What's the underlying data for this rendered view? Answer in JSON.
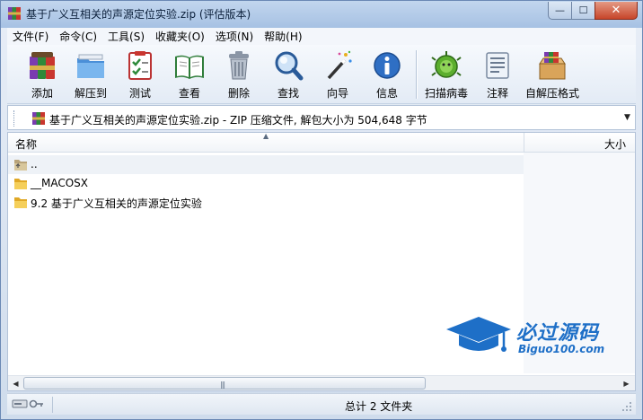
{
  "window": {
    "title": "基于广义互相关的声源定位实验.zip (评估版本)",
    "controls": {
      "minimize": "—",
      "maximize": "☐",
      "close": "✕"
    }
  },
  "menu": [
    "文件(F)",
    "命令(C)",
    "工具(S)",
    "收藏夹(O)",
    "选项(N)",
    "帮助(H)"
  ],
  "toolbar": {
    "items": [
      {
        "label": "添加",
        "icon": "add-archive-icon"
      },
      {
        "label": "解压到",
        "icon": "extract-folder-icon"
      },
      {
        "label": "测试",
        "icon": "test-checklist-icon"
      },
      {
        "label": "查看",
        "icon": "view-book-icon"
      },
      {
        "label": "删除",
        "icon": "trash-icon"
      },
      {
        "label": "查找",
        "icon": "find-magnifier-icon"
      },
      {
        "label": "向导",
        "icon": "wizard-wand-icon"
      },
      {
        "label": "信息",
        "icon": "info-icon"
      },
      {
        "label": "扫描病毒",
        "icon": "virus-scan-icon"
      },
      {
        "label": "注释",
        "icon": "comment-icon"
      },
      {
        "label": "自解压格式",
        "icon": "sfx-box-icon"
      }
    ]
  },
  "address": {
    "text": "基于广义互相关的声源定位实验.zip - ZIP 压缩文件, 解包大小为 504,648 字节",
    "dropdown": "▼"
  },
  "filelist": {
    "columns": {
      "name": "名称",
      "size": "大小",
      "sort_indicator": "▲"
    },
    "rows": [
      {
        "name": "..",
        "icon": "parent-folder-icon"
      },
      {
        "name": "__MACOSX",
        "icon": "folder-icon"
      },
      {
        "name": "9.2 基于广义互相关的声源定位实验",
        "icon": "folder-icon"
      }
    ]
  },
  "scrollbar": {
    "left": "◀",
    "right": "▶",
    "grip": "|||"
  },
  "watermark": {
    "title": "必过源码",
    "subtitle": "Biguo100.com"
  },
  "status": {
    "text": "总计 2 文件夹"
  },
  "colors": {
    "accent": "#1e6fc7",
    "titlebar": "#a6c1e3",
    "close": "#c7452a"
  }
}
